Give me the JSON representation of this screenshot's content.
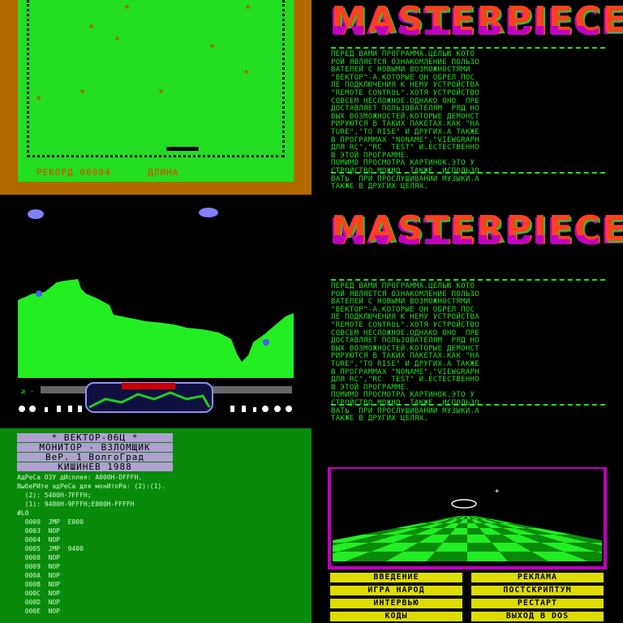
{
  "snake_game": {
    "record_label": "РЕКОРД 00004",
    "length_label": "ДЛИНА"
  },
  "masterpiece_top": {
    "logo_text": "MASTERPIECE",
    "lines": [
      "ПЕРЕД ВАМИ ПРОГРАММА.ЦЕЛЬЮ КОТО",
      "РОЙ ЯВЛЯЕТСЯ ОЗНАКОМЛЕНИЕ ПОЛЬЗО",
      "ВАТЕЛЕЙ С НОВЫМИ ВОЗМОЖНОСТЯМИ",
      "\"ВЕКТОР\"-А.КОТОРЫЕ ОН ОБРЕЛ ПОС",
      "ЛЕ ПОДКЛЮЧЕНИЯ К НЕМУ УСТРОЙСТВА",
      "\"REMOTE CONTROL\".ХОТЯ УСТРОЙСТВО",
      "СОВСЕМ НЕСЛОЖНОЕ.ОДНАКО ОНО  ПРЕ",
      "ДОСТАВЛЯЕТ ПОЛЬЗОВАТЕЛЯМ  РЯД НО",
      "ВЫХ ВОЗМОЖНОСТЕЙ.КОТОРЫЕ ДЕМОНСТ",
      "РИРУЮТСЯ В ТАКИХ ПАКЕТАХ.КАК \"НА",
      "TURE\",\"TO RISE\" И ДРУГИХ.А ТАКЖЕ",
      "В ПРОГРАММАХ \"NONAME\",\"VIEWGRAPH",
      "ДЛЯ RC\",\"RC  TEST\" И.ЕСТЕСТВЕННО",
      "В ЭТОЙ ПРОГРАММЕ.",
      "ПОМИМО ПРОСМОТРА КАРТИНОК.ЭТО У",
      "СТРОЙСТВО МОЖНО  ТАКЖЕ  ИСПОЛЬЗО",
      "ВАТЬ  ПРИ ПРОСЛУШИВАНИИ МУЗЫКИ.А",
      "ТАКЖЕ В ДРУГИХ ЦЕЛЯХ."
    ]
  },
  "masterpiece_bottom": {
    "logo_text": "MASTERPIECE",
    "lines": [
      "ПЕРЕД ВАМИ ПРОГРАММА.ЦЕЛЬЮ КОТО",
      "РОЙ ЯВЛЯЕТСЯ ОЗНАКОМЛЕНИЕ ПОЛЬЗО",
      "ВАТЕЛЕЙ С НОВЫМИ ВОЗМОЖНОСТЯМИ",
      "\"ВЕКТОР\"-А.КОТОРЫЕ ОН ОБРЕЛ ПОС",
      "ЛЕ ПОДКЛЮЧЕНИЯ К НЕМУ УСТРОЙСТВА",
      "\"REMOTE CONTROL\".ХОТЯ УСТРОЙСТВО",
      "СОВСЕМ НЕСЛОЖНОЕ.ОДНАКО ОНО  ПРЕ",
      "ДОСТАВЛЯЕТ ПОЛЬЗОВАТЕЛЯМ  РЯД НО",
      "ВЫХ ВОЗМОЖНОСТЕЙ.КОТОРЫЕ ДЕМОНСТ",
      "РИРУЮТСЯ В ТАКИХ ПАКЕТАХ.КАК \"НА",
      "TURE\",\"TO RISE\" И ДРУГИХ.А ТАКЖЕ",
      "В ПРОГРАММАХ \"NONAME\",\"VIEWGRAPH",
      "ДЛЯ RC\",\"RC  TEST\" И.ЕСТЕСТВЕННО",
      "В ЭТОЙ ПРОГРАММЕ.",
      "ПОМИМО ПРОСМОТРА КАРТИНОК.ЭТО У",
      "СТРОЙСТВО МОЖНО  ТАКЖЕ  ИСПОЛЬЗО",
      "ВАТЬ  ПРИ ПРОСЛУШИВАНИИ МУЗЫКИ.А",
      "ТАКЖЕ В ДРУГИХ ЦЕЛЯХ."
    ]
  },
  "monitor": {
    "title_lines": [
      "* ВЕКТОР-06Ц *",
      "МОНИТОР - ВЗЛОМЩИК",
      "ВеР. 1  ВолгоГрад",
      "КИШИНЕВ 1988"
    ],
    "lines": [
      "АдРеСа ОЗУ дИсплея: A000H-DFFFH.",
      "ВыбеРИте адРеСа для монИтоРа: (2):(1).",
      "  (2): 5400H-7FFFH;",
      "  (1): 9400H-9FFFH;E000H-FFFFH",
      "#L0",
      "  0000  JMP  E000",
      "  0003  NOP",
      "  0004  NOP",
      "  0005  JMP  9400",
      "  0008  NOP",
      "  0009  NOP",
      "  000A  NOP",
      "  000B  NOP",
      "  000C  NOP",
      "  000D  NOP",
      "  000E  NOP"
    ]
  },
  "menu_3d": {
    "buttons": [
      "ВВЕДЕНИЕ",
      "РЕКЛАМА",
      "ИГРА НАРОД",
      "ПОСТСКРИПТУМ",
      "ИНТЕРВЬЮ",
      "РЕСТАРТ",
      "КОДЫ",
      "ВЫХОД В DOS"
    ]
  },
  "colors": {
    "green": "#22dd22",
    "orange": "#b06a00",
    "yellow": "#dddd00",
    "magenta": "#c000c0",
    "red": "#ff4020"
  }
}
